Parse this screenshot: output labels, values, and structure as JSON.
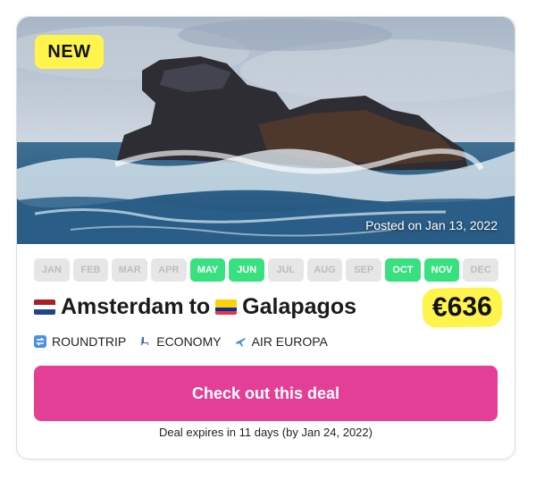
{
  "badge": {
    "label": "NEW"
  },
  "hero": {
    "posted": "Posted on Jan 13, 2022"
  },
  "months": [
    {
      "label": "JAN",
      "active": false
    },
    {
      "label": "FEB",
      "active": false
    },
    {
      "label": "MAR",
      "active": false
    },
    {
      "label": "APR",
      "active": false
    },
    {
      "label": "MAY",
      "active": true
    },
    {
      "label": "JUN",
      "active": true
    },
    {
      "label": "JUL",
      "active": false
    },
    {
      "label": "AUG",
      "active": false
    },
    {
      "label": "SEP",
      "active": false
    },
    {
      "label": "OCT",
      "active": true
    },
    {
      "label": "NOV",
      "active": true
    },
    {
      "label": "DEC",
      "active": false
    }
  ],
  "route": {
    "from": "Amsterdam",
    "connector": "to",
    "to": "Galapagos",
    "from_flag": "flag-netherlands",
    "to_flag": "flag-ecuador"
  },
  "price": "€636",
  "meta": {
    "trip_type": "ROUNDTRIP",
    "cabin": "ECONOMY",
    "airline": "AIR EUROPA"
  },
  "cta": {
    "label": "Check out this deal"
  },
  "expires": "Deal expires in 11 days (by Jan 24, 2022)",
  "colors": {
    "accent_pink": "#e43f96",
    "highlight_yellow": "#fff44b",
    "active_month_green": "#39e07f"
  }
}
